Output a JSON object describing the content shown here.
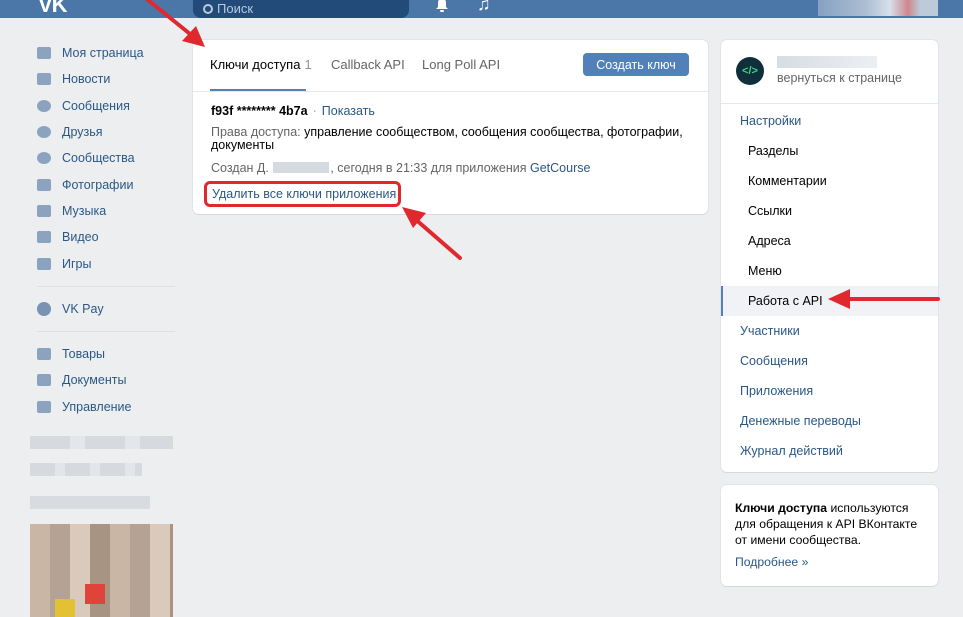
{
  "header": {
    "logo": "VK",
    "search_placeholder": "Поиск"
  },
  "leftnav": {
    "items": [
      {
        "label": "Моя страница",
        "icon": "home-icon"
      },
      {
        "label": "Новости",
        "icon": "news-icon"
      },
      {
        "label": "Сообщения",
        "icon": "messages-icon"
      },
      {
        "label": "Друзья",
        "icon": "friends-icon"
      },
      {
        "label": "Сообщества",
        "icon": "communities-icon"
      },
      {
        "label": "Фотографии",
        "icon": "camera-icon"
      },
      {
        "label": "Музыка",
        "icon": "music-icon"
      },
      {
        "label": "Видео",
        "icon": "video-icon"
      },
      {
        "label": "Игры",
        "icon": "gamepad-icon"
      }
    ],
    "pay": {
      "label": "VK Pay",
      "icon": "vkpay-icon"
    },
    "extra": [
      {
        "label": "Товары",
        "icon": "bag-icon"
      },
      {
        "label": "Документы",
        "icon": "document-icon"
      },
      {
        "label": "Управление",
        "icon": "gamepad-icon"
      }
    ]
  },
  "main": {
    "tabs": [
      {
        "label": "Ключи доступа",
        "count": "1"
      },
      {
        "label": "Callback API"
      },
      {
        "label": "Long Poll API"
      }
    ],
    "create_button": "Создать ключ",
    "key": {
      "value": "f93f ******** 4b7a",
      "separator": "·",
      "show_link": "Показать",
      "rights_label": "Права доступа:",
      "rights_value": "управление сообществом, сообщения сообщества, фотографии, документы",
      "created_prefix": "Создан Д.",
      "created_suffix": ", сегодня в 21:33 для приложения",
      "app_name": "GetCourse"
    },
    "delete_all": "Удалить все ключи приложения"
  },
  "rightmenu": {
    "group_avatar": "</>",
    "back_link": "вернуться к странице",
    "items": [
      {
        "label": "Настройки",
        "level": "top"
      },
      {
        "label": "Разделы",
        "level": "sub"
      },
      {
        "label": "Комментарии",
        "level": "sub"
      },
      {
        "label": "Ссылки",
        "level": "sub"
      },
      {
        "label": "Адреса",
        "level": "sub"
      },
      {
        "label": "Меню",
        "level": "sub"
      },
      {
        "label": "Работа с API",
        "level": "sub",
        "active": true
      },
      {
        "label": "Участники",
        "level": "top"
      },
      {
        "label": "Сообщения",
        "level": "top"
      },
      {
        "label": "Приложения",
        "level": "top"
      },
      {
        "label": "Денежные переводы",
        "level": "top"
      },
      {
        "label": "Журнал действий",
        "level": "top"
      }
    ]
  },
  "info": {
    "bold": "Ключи доступа",
    "text": " используются для обращения к API ВКонтакте от имени сообщества.",
    "more": "Подробнее »"
  },
  "colors": {
    "header": "#4a76a8",
    "link": "#2a5885",
    "button": "#5181b8",
    "annotation": "#e0292f"
  }
}
